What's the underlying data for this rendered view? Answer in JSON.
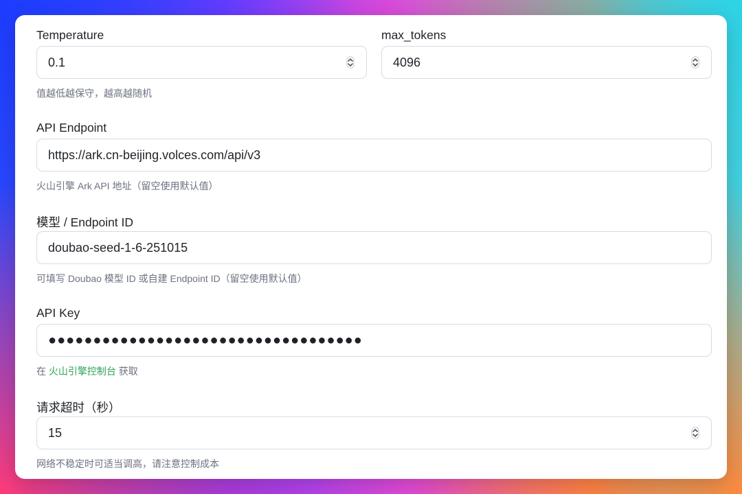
{
  "form": {
    "temperature": {
      "label": "Temperature",
      "value": "0.1",
      "help": "值越低越保守，越高越随机"
    },
    "max_tokens": {
      "label": "max_tokens",
      "value": "4096"
    },
    "endpoint": {
      "label": "API Endpoint",
      "value": "https://ark.cn-beijing.volces.com/api/v3",
      "help": "火山引擎 Ark API 地址（留空使用默认值）"
    },
    "model": {
      "label": "模型 / Endpoint ID",
      "value": "doubao-seed-1-6-251015",
      "help": "可填写 Doubao 模型 ID 或自建 Endpoint ID（留空使用默认值）"
    },
    "api_key": {
      "label": "API Key",
      "value": "●●●●●●●●●●●●●●●●●●●●●●●●●●●●●●●●●●●",
      "help_prefix": "在",
      "help_link": "火山引擎控制台",
      "help_suffix": "获取"
    },
    "timeout": {
      "label": "请求超时（秒）",
      "value": "15",
      "help": "网络不稳定时可适当调高，请注意控制成本"
    }
  },
  "icons": {
    "stepper": "stepper-icon"
  },
  "colors": {
    "link": "#2fa35a",
    "help_text": "#6b7280",
    "border": "#d7dbe0"
  }
}
